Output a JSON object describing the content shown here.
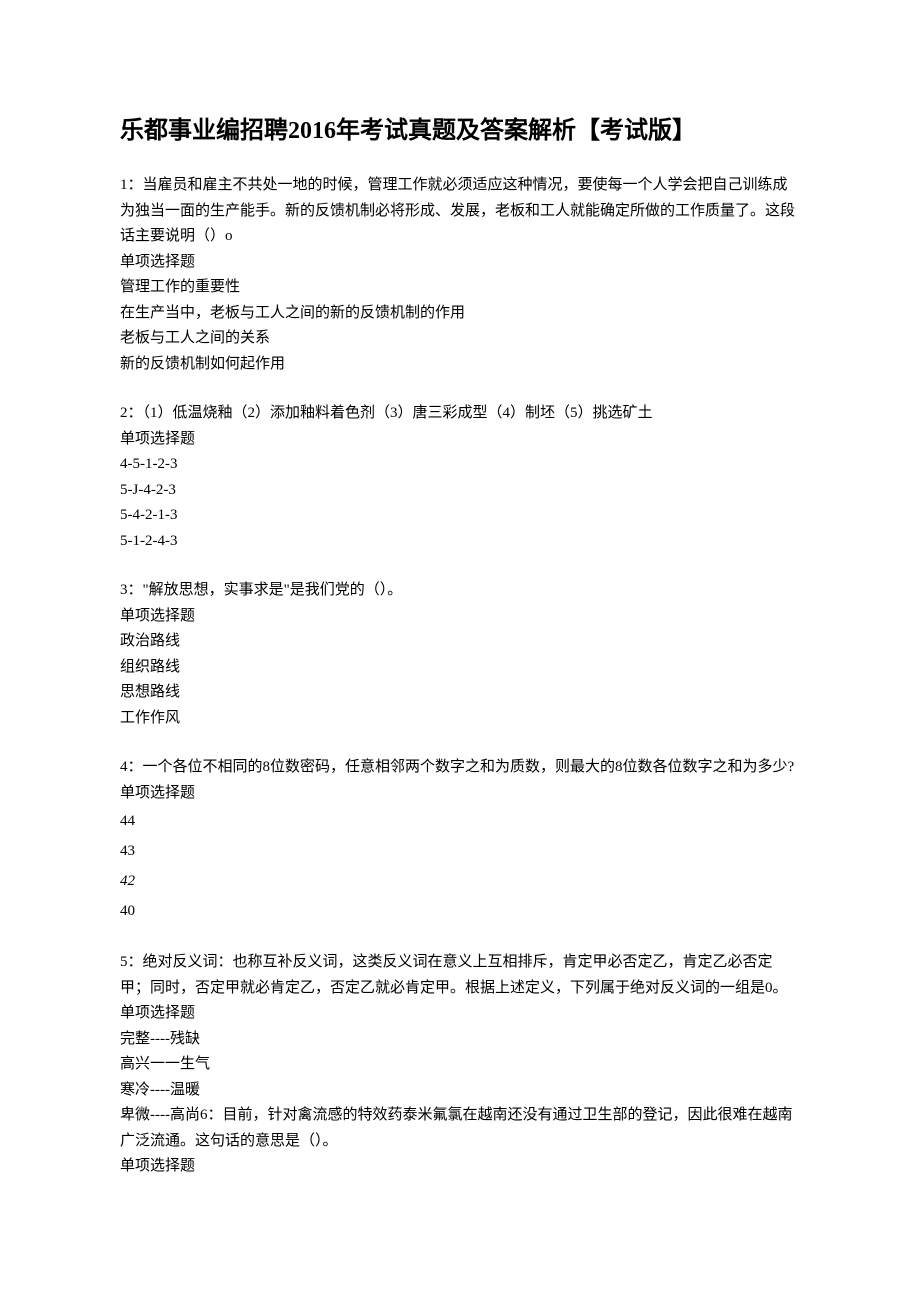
{
  "title": "乐都事业编招聘2016年考试真题及答案解析【考试版】",
  "questions": [
    {
      "prompt": "1：当雇员和雇主不共处一地的时候，管理工作就必须适应这种情况，要使每一个人学会把自己训练成为独当一面的生产能手。新的反馈机制必将形成、发展，老板和工人就能确定所做的工作质量了。这段话主要说明（）o",
      "type_label": "单项选择题",
      "options": [
        "管理工作的重要性",
        "在生产当中，老板与工人之间的新的反馈机制的作用",
        "老板与工人之间的关系",
        "新的反馈机制如何起作用"
      ]
    },
    {
      "prompt": "2：（1）低温烧釉（2）添加釉料着色剂（3）唐三彩成型（4）制坯（5）挑选矿土",
      "type_label": "单项选择题",
      "options": [
        "4-5-1-2-3",
        "5-J-4-2-3",
        "5-4-2-1-3",
        "5-1-2-4-3"
      ]
    },
    {
      "prompt": "3：\"解放思想，实事求是\"是我们党的（）。",
      "type_label": "单项选择题",
      "options": [
        "政治路线",
        "组织路线",
        "思想路线",
        "工作作风"
      ]
    },
    {
      "prompt": "4：一个各位不相同的8位数密码，任意相邻两个数字之和为质数，则最大的8位数各位数字之和为多少?",
      "type_label": "单项选择题",
      "options": [
        "44",
        "43",
        "42",
        "40"
      ],
      "italic_index": 2
    },
    {
      "prompt": "5：绝对反义词：也称互补反义词，这类反义词在意义上互相排斥，肯定甲必否定乙，肯定乙必否定甲；同时，否定甲就必肯定乙，否定乙就必肯定甲。根据上述定义，下列属于绝对反义词的一组是0。",
      "type_label": "单项选择题",
      "options": [
        "完整----残缺",
        "高兴一一生气",
        "寒冷----温暖",
        "卑微----高尚6：目前，针对禽流感的特效药泰米氟氯在越南还没有通过卫生部的登记，因此很难在越南广泛流通。这句话的意思是（）。"
      ],
      "trailing_type_label": "单项选择题"
    }
  ]
}
